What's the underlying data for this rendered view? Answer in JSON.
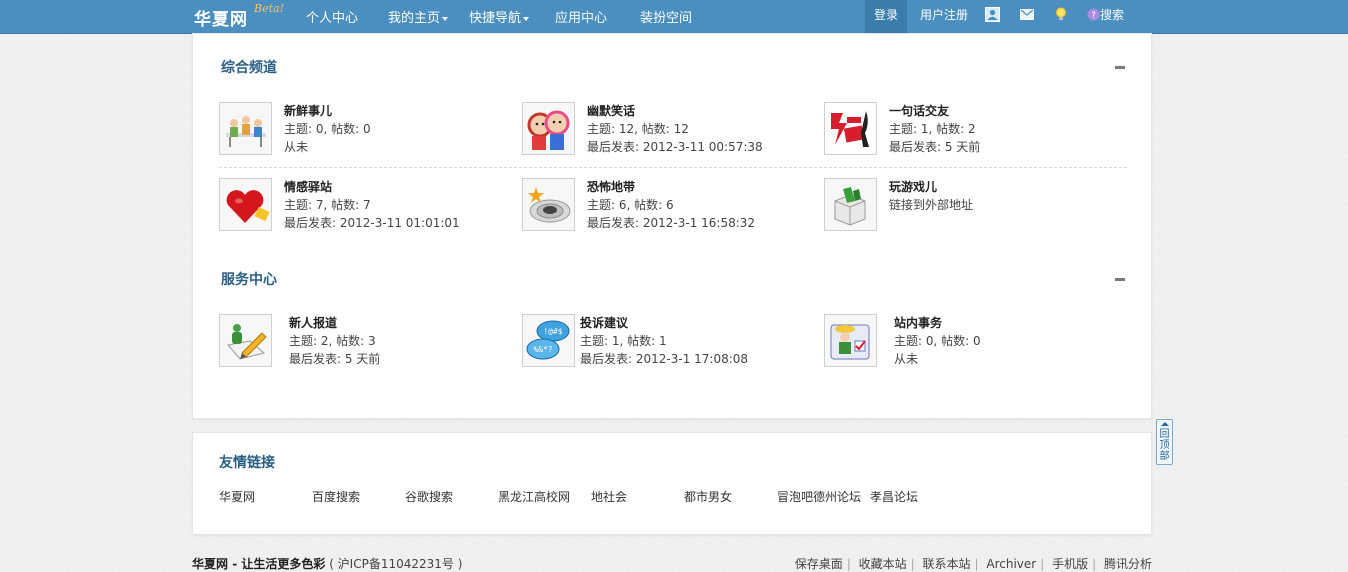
{
  "nav": {
    "logo": "华夏网",
    "beta": "Beta!",
    "items": [
      "个人中心",
      "我的主页",
      "快捷导航",
      "应用中心",
      "装扮空间"
    ],
    "login": "登录",
    "register": "用户注册",
    "search": "搜索"
  },
  "sections": [
    {
      "title": "综合频道",
      "forums": [
        {
          "name": "新鲜事儿",
          "line1": "主题: 0, 帖数: 0",
          "line2": "从未"
        },
        {
          "name": "幽默笑话",
          "line1": "主题: 12, 帖数: 12",
          "line2": "最后发表: 2012-3-11 00:57:38"
        },
        {
          "name": "一句话交友",
          "line1": "主题: 1, 帖数: 2",
          "line2": "最后发表: 5 天前"
        },
        {
          "name": "情感驿站",
          "line1": "主题: 7, 帖数: 7",
          "line2": "最后发表: 2012-3-11 01:01:01"
        },
        {
          "name": "恐怖地带",
          "line1": "主题: 6, 帖数: 6",
          "line2": "最后发表: 2012-3-1 16:58:32"
        },
        {
          "name": "玩游戏儿",
          "line1": "链接到外部地址",
          "line2": ""
        }
      ]
    },
    {
      "title": "服务中心",
      "forums": [
        {
          "name": "新人报道",
          "line1": "主题: 2, 帖数: 3",
          "line2": "最后发表: 5 天前"
        },
        {
          "name": "投诉建议",
          "line1": "主题: 1, 帖数: 1",
          "line2": "最后发表: 2012-3-1 17:08:08"
        },
        {
          "name": "站内事务",
          "line1": "主题: 0, 帖数: 0",
          "line2": "从未"
        }
      ]
    }
  ],
  "links": {
    "title": "友情链接",
    "items": [
      "华夏网",
      "百度搜索",
      "谷歌搜索",
      "黑龙江高校网",
      "地社会",
      "都市男女",
      "冒泡吧德州论坛",
      "孝昌论坛"
    ]
  },
  "backtop": "回顶部",
  "footer": {
    "site": "华夏网",
    "slogan": " - 让生活更多色彩",
    "icp": "( 沪ICP备11042231号 )",
    "links": [
      "保存桌面",
      "收藏本站",
      "联系本站",
      "Archiver",
      "手机版",
      "腾讯分析"
    ]
  },
  "colors": {
    "nav_bg": "#4a8fbf",
    "title": "#2a5f84"
  }
}
